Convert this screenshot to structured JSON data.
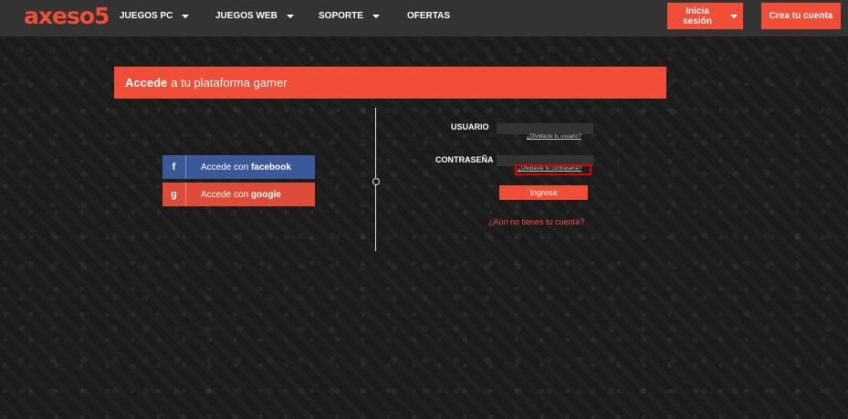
{
  "header": {
    "logo": "axeso5",
    "nav": [
      {
        "label": "JUEGOS PC",
        "dropdown": true
      },
      {
        "label": "JUEGOS WEB",
        "dropdown": true
      },
      {
        "label": "SOPORTE",
        "dropdown": true
      },
      {
        "label": "OFERTAS",
        "dropdown": false
      }
    ],
    "login_label": "Inicia sesión",
    "signup_label": "Crea tu cuenta"
  },
  "login": {
    "title_bold": "Accede",
    "title_rest": "a tu plataforma gamer",
    "facebook": {
      "icon": "f",
      "prefix": "Accede con",
      "brand": "facebook"
    },
    "google": {
      "icon": "g",
      "prefix": "Accede con",
      "brand": "google"
    },
    "username_label": "USUARIO",
    "username_value": "",
    "forgot_username": "¿Olvidaste tu usuario?",
    "password_label": "CONTRASEÑA",
    "password_value": "",
    "forgot_password": "¿Olvidaste tu contraseña?",
    "submit_label": "Ingresa",
    "register_link": "¿Aún no tienes tu cuenta?"
  },
  "colors": {
    "accent": "#f04e37",
    "facebook": "#3b5998",
    "google": "#dd4b39",
    "topbar": "#333333"
  }
}
